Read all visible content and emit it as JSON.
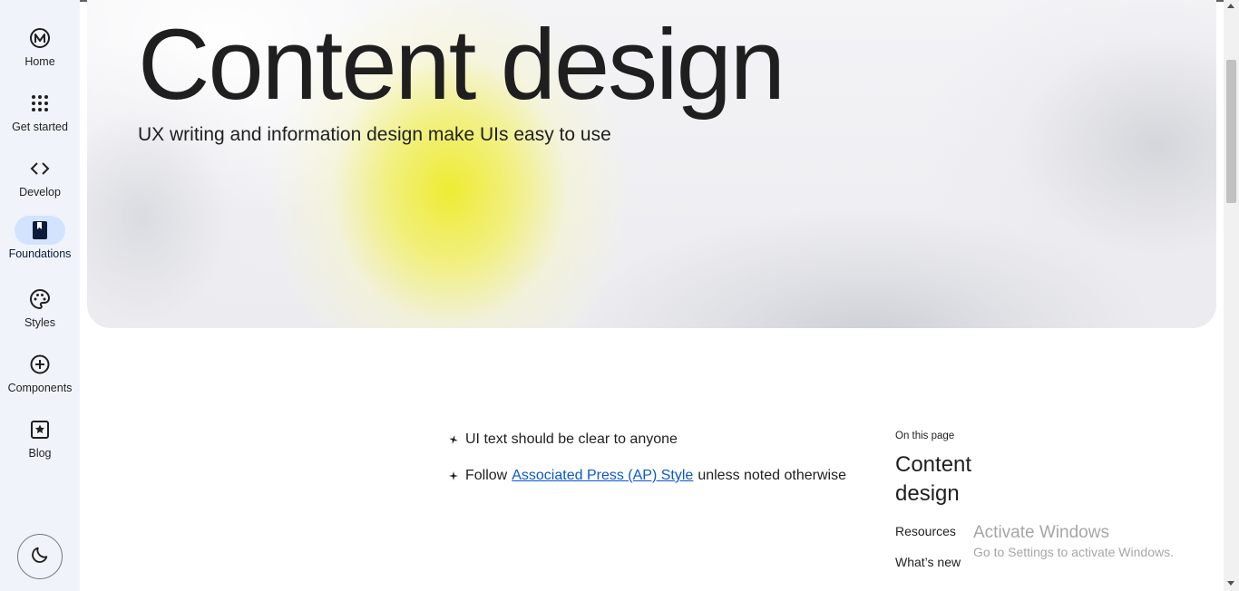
{
  "nav": {
    "items": [
      {
        "label": "Home",
        "icon": "material-logo-icon"
      },
      {
        "label": "Get started",
        "icon": "apps-grid-icon"
      },
      {
        "label": "Develop",
        "icon": "code-icon"
      },
      {
        "label": "Foundations",
        "icon": "book-icon",
        "active": true
      },
      {
        "label": "Styles",
        "icon": "palette-icon"
      },
      {
        "label": "Components",
        "icon": "add-circle-icon"
      },
      {
        "label": "Blog",
        "icon": "star-box-icon"
      }
    ],
    "theme_toggle_icon": "moon-icon",
    "active_color": "#d3e3fd",
    "rail_color": "#f0f4fa"
  },
  "hero": {
    "title": "Content design",
    "subtitle": "UX writing and information design make UIs easy to use",
    "accent_color": "#eeeb28"
  },
  "content": {
    "bullets": [
      {
        "text": "UI text should be clear to anyone"
      },
      {
        "prefix": "Follow",
        "link": "Associated Press (AP) Style",
        "suffix": "unless noted otherwise"
      }
    ],
    "link_color": "#0b57d0"
  },
  "toc": {
    "heading": "On this page",
    "title": "Content design",
    "links": [
      "Resources",
      "What’s new"
    ]
  },
  "watermark": {
    "title": "Activate Windows",
    "subtitle": "Go to Settings to activate Windows."
  }
}
